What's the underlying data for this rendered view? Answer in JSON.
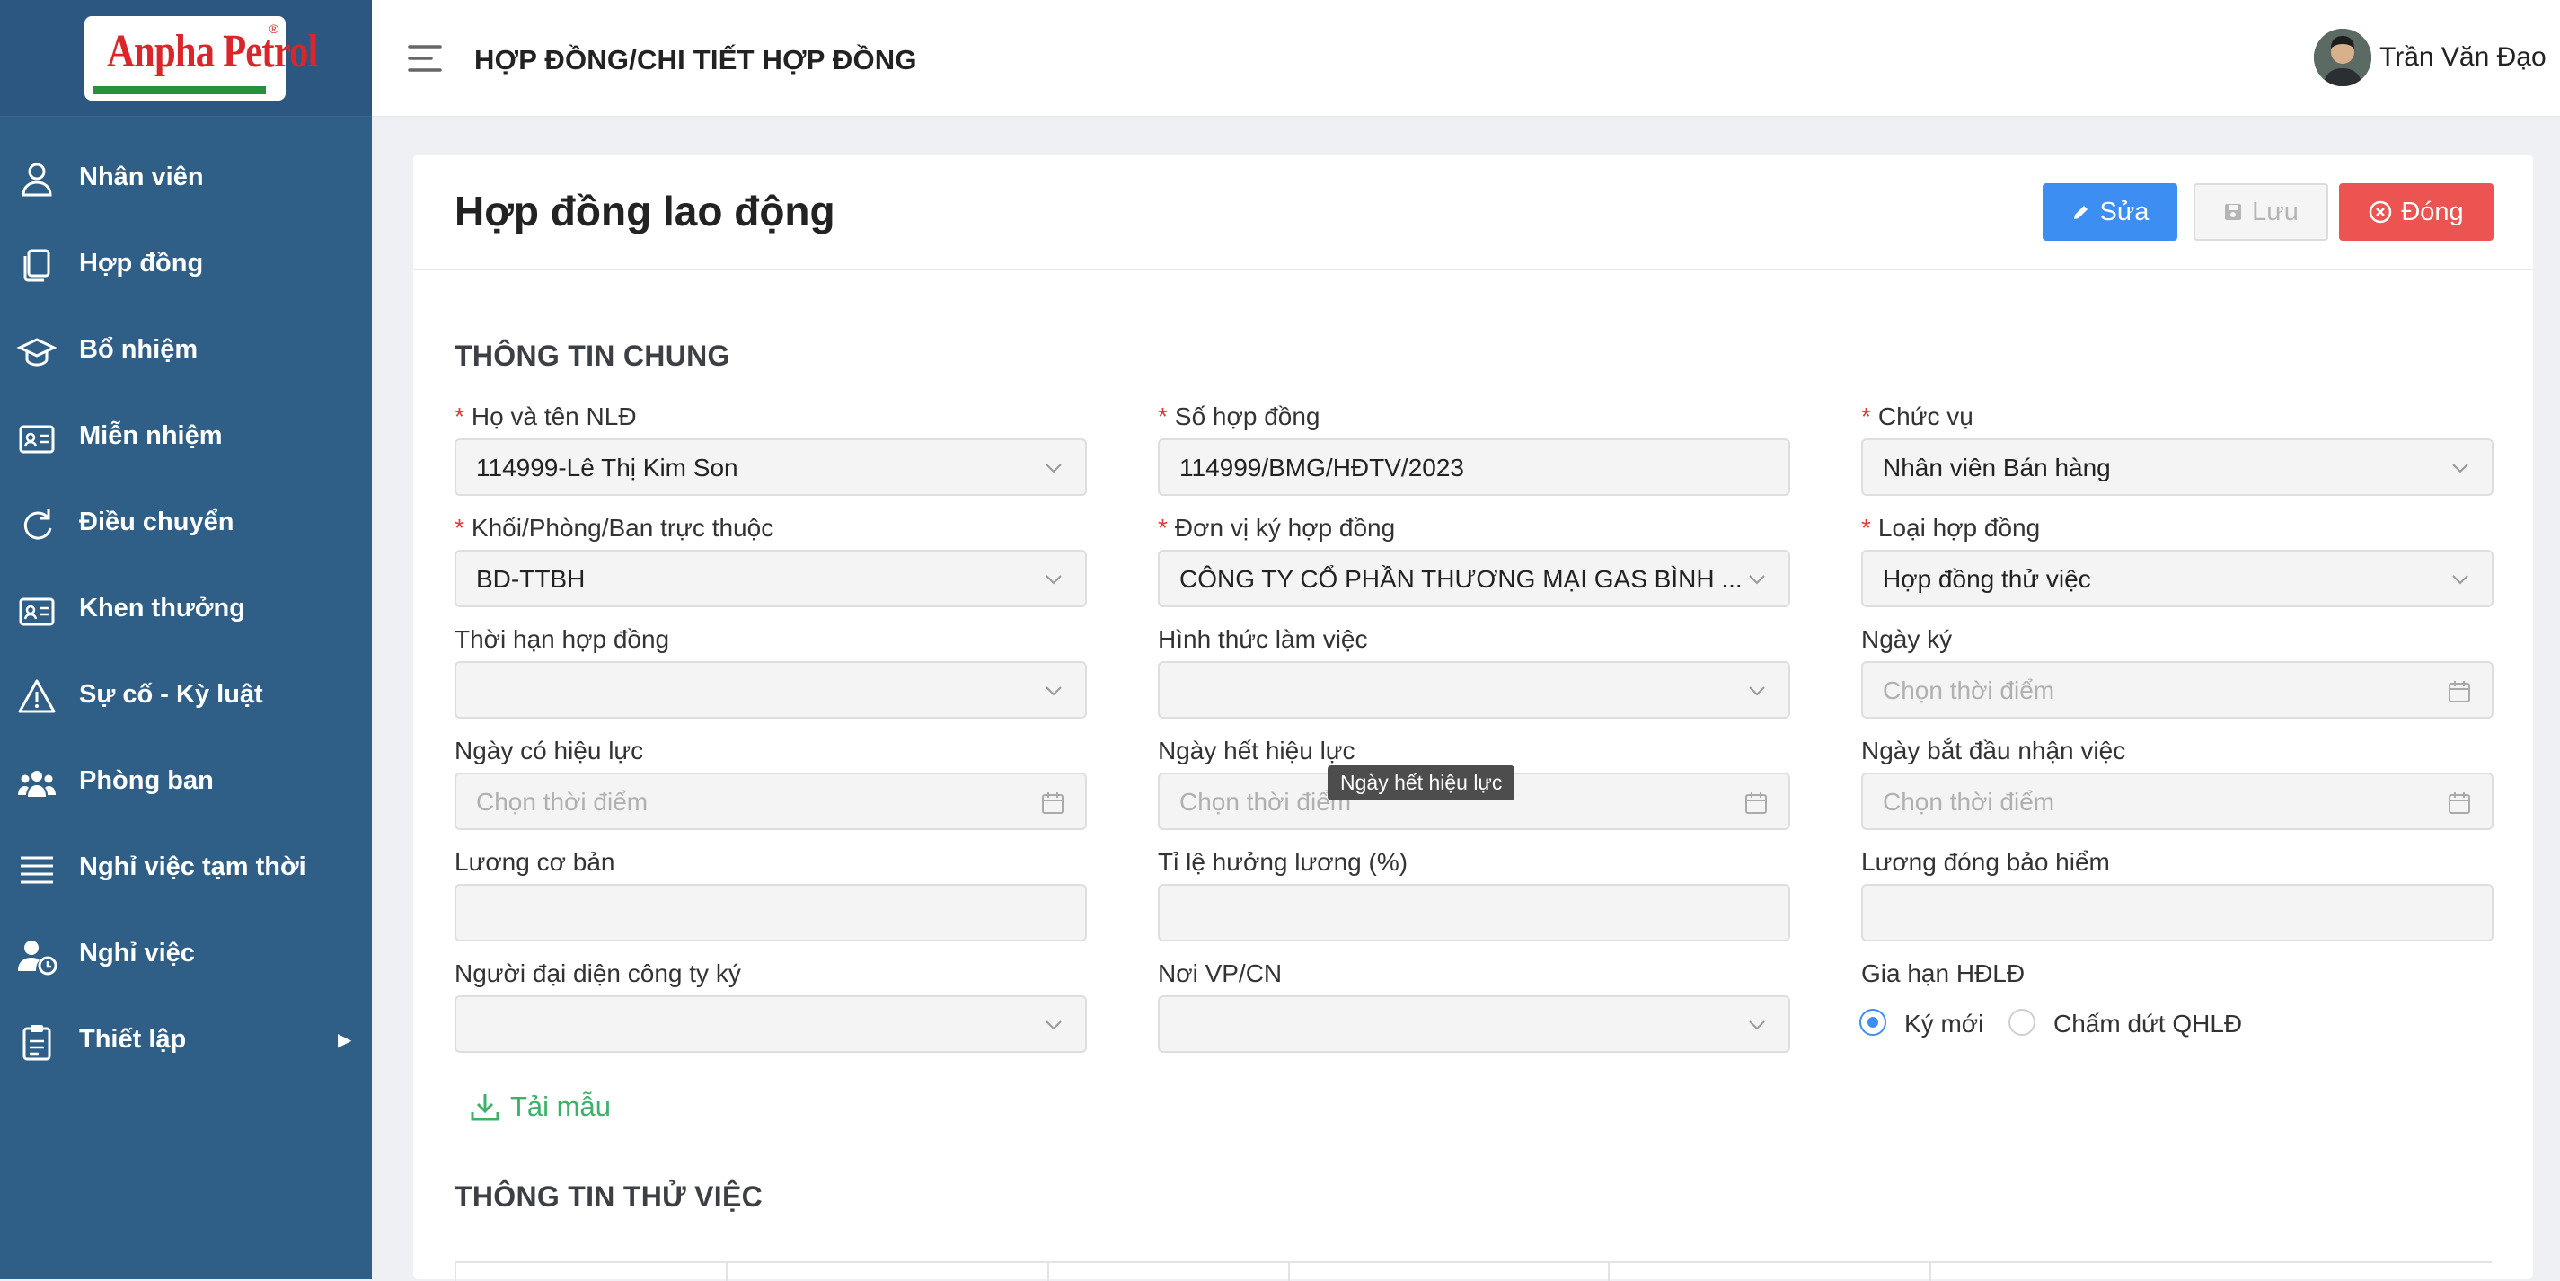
{
  "brand": {
    "logo_text": "Anpha Petrol",
    "logo_reg": "®"
  },
  "sidebar": {
    "items": [
      {
        "label": "Nhân viên",
        "icon": "user-icon"
      },
      {
        "label": "Hợp đồng",
        "icon": "documents-icon"
      },
      {
        "label": "Bổ nhiệm",
        "icon": "graduation-cap-icon"
      },
      {
        "label": "Miễn nhiệm",
        "icon": "id-card-icon"
      },
      {
        "label": "Điều chuyển",
        "icon": "refresh-icon"
      },
      {
        "label": "Khen thưởng",
        "icon": "id-card-icon"
      },
      {
        "label": "Sự cố - Kỳ luật",
        "icon": "warning-icon"
      },
      {
        "label": "Phòng ban",
        "icon": "team-icon"
      },
      {
        "label": "Nghỉ việc tạm thời",
        "icon": "list-icon"
      },
      {
        "label": "Nghỉ việc",
        "icon": "user-clock-icon"
      },
      {
        "label": "Thiết lập",
        "icon": "clipboard-icon"
      }
    ]
  },
  "header": {
    "breadcrumb": "HỢP ĐỒNG/CHI TIẾT HỢP ĐỒNG",
    "user_name": "Trần Văn Đạo"
  },
  "page": {
    "title": "Hợp đồng lao động",
    "buttons": {
      "edit": "Sửa",
      "save": "Lưu",
      "close": "Đóng"
    },
    "section_general": "THÔNG TIN CHUNG",
    "section_probation": "THÔNG TIN THỬ VIỆC",
    "download_label": "Tải mẫu",
    "tooltip": "Ngày hết hiệu lực"
  },
  "fields": {
    "employee": {
      "label": "Họ và tên NLĐ",
      "value": "114999-Lê Thị Kim Son"
    },
    "contract_no": {
      "label": "Số hợp đồng",
      "value": "114999/BMG/HĐTV/2023"
    },
    "position": {
      "label": "Chức vụ",
      "value": "Nhân viên Bán hàng"
    },
    "department": {
      "label": "Khối/Phòng/Ban trực thuộc",
      "value": "BD-TTBH"
    },
    "signing_unit": {
      "label": "Đơn vị ký hợp đồng",
      "value": "CÔNG TY CỔ PHẦN THƯƠNG MẠI GAS BÌNH ..."
    },
    "contract_type": {
      "label": "Loại hợp đồng",
      "value": "Hợp đồng thử việc"
    },
    "term": {
      "label": "Thời hạn hợp đồng",
      "value": ""
    },
    "work_form": {
      "label": "Hình thức làm việc",
      "value": ""
    },
    "sign_date": {
      "label": "Ngày ký",
      "placeholder": "Chọn thời điểm"
    },
    "effective_date": {
      "label": "Ngày có hiệu lực",
      "placeholder": "Chọn thời điểm"
    },
    "expiry_date": {
      "label": "Ngày hết hiệu lực",
      "placeholder": "Chọn thời điểm"
    },
    "start_date": {
      "label": "Ngày bắt đầu nhận việc",
      "placeholder": "Chọn thời điểm"
    },
    "base_salary": {
      "label": "Lương cơ bản",
      "value": ""
    },
    "salary_rate": {
      "label": "Tỉ lệ hưởng lương (%)",
      "value": ""
    },
    "insurance_salary": {
      "label": "Lương đóng bảo hiểm",
      "value": ""
    },
    "representative": {
      "label": "Người đại diện công ty ký",
      "value": ""
    },
    "office": {
      "label": "Nơi VP/CN",
      "value": ""
    },
    "extension": {
      "label": "Gia hạn HĐLĐ",
      "options": [
        "Ký mới",
        "Chấm dứt QHLĐ"
      ],
      "selected": "Ký mới"
    }
  },
  "colors": {
    "sidebar": "#2f5f87",
    "primary": "#3d8ef2",
    "danger": "#eb5450",
    "success": "#3fb06a"
  }
}
